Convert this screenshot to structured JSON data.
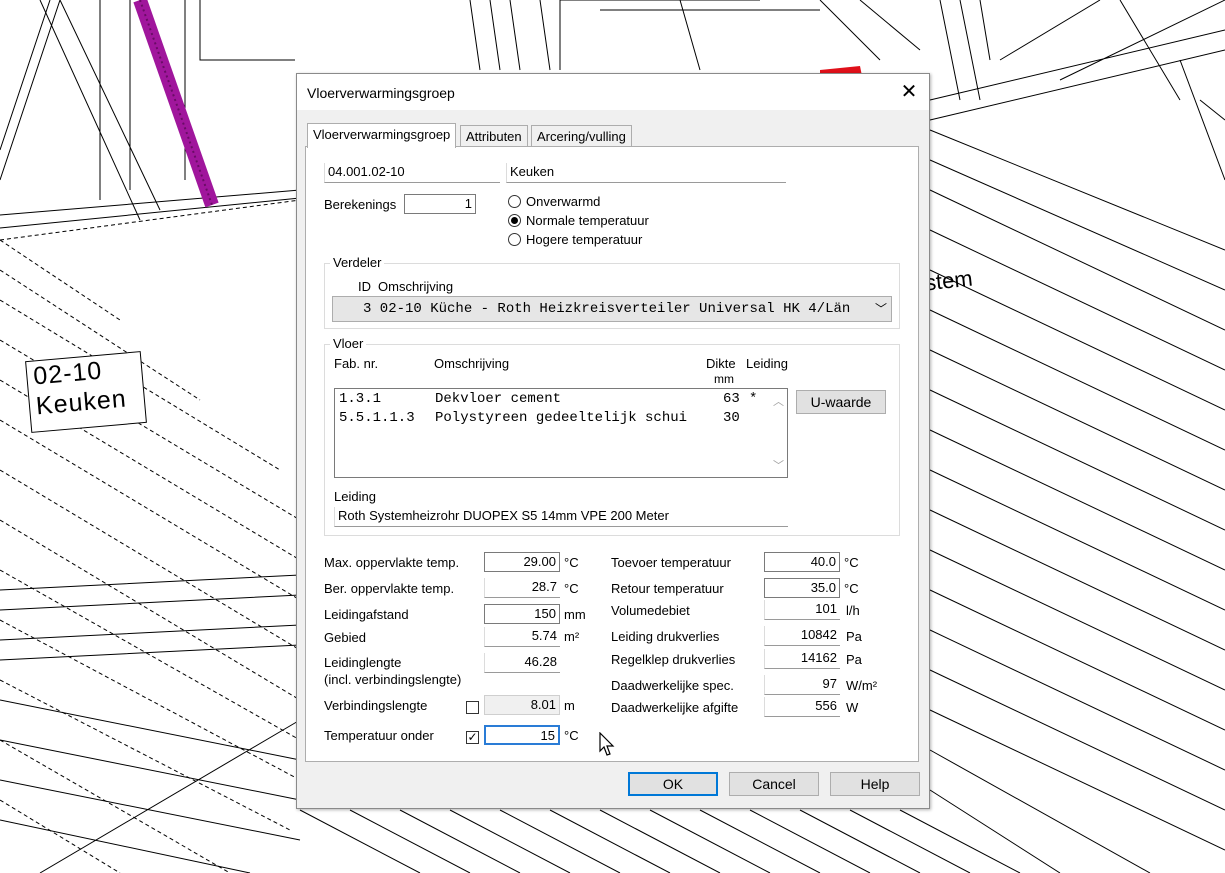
{
  "cad": {
    "room_label": {
      "number": "02-10",
      "name": "Keuken"
    },
    "partial_text": "stem"
  },
  "dialog": {
    "title": "Vloerverwarmingsgroep",
    "tabs": [
      "Vloerverwarmingsgroep",
      "Attributen",
      "Arcering/vulling"
    ],
    "active_tab": 0,
    "group_id": "04.001.02-10",
    "room_name": "Keuken",
    "berekening_label": "Berekenings",
    "berekening_value": "1",
    "temperature_options": [
      {
        "label": "Onverwarmd",
        "selected": false
      },
      {
        "label": "Normale temperatuur",
        "selected": true
      },
      {
        "label": "Hogere temperatuur",
        "selected": false
      }
    ],
    "verdeler": {
      "group_label": "Verdeler",
      "col_id": "ID",
      "col_desc": "Omschrijving",
      "selected": "3 02-10 Küche - Roth Heizkreisverteiler Universal HK 4/Län"
    },
    "vloer": {
      "group_label": "Vloer",
      "col_fab": "Fab. nr.",
      "col_desc": "Omschrijving",
      "col_dikte": "Dikte",
      "col_dikte_unit": "mm",
      "col_leiding": "Leiding",
      "rows": [
        {
          "fab": "1.3.1",
          "desc": "Dekvloer cement",
          "dikte": "63",
          "leiding": "*"
        },
        {
          "fab": "5.5.1.1.3",
          "desc": "Polystyreen gedeeltelijk schui",
          "dikte": "30",
          "leiding": ""
        }
      ],
      "uwaarde_button": "U-waarde",
      "leiding_label": "Leiding",
      "leiding_value": "Roth Systemheizrohr DUOPEX S5 14mm VPE 200 Meter"
    },
    "left_fields": [
      {
        "label": "Max. oppervlakte temp.",
        "value": "29.00",
        "unit": "°C"
      },
      {
        "label": "Ber. oppervlakte temp.",
        "value": "28.7",
        "unit": "°C"
      },
      {
        "label": "Leidingafstand",
        "value": "150",
        "unit": "mm"
      },
      {
        "label": "Gebied",
        "value": "5.74",
        "unit": "m²"
      },
      {
        "label": "Leidinglengte",
        "label2": "(incl. verbindingslengte)",
        "value": "46.28",
        "unit": ""
      },
      {
        "label": "Verbindingslengte",
        "value": "8.01",
        "unit": "m",
        "checkbox": false
      },
      {
        "label": "Temperatuur onder",
        "value": "15",
        "unit": "°C",
        "checkbox": true
      }
    ],
    "right_fields": [
      {
        "label": "Toevoer temperatuur",
        "value": "40.0",
        "unit": "°C"
      },
      {
        "label": "Retour temperatuur",
        "value": "35.0",
        "unit": "°C"
      },
      {
        "label": "Volumedebiet",
        "value": "101",
        "unit": "l/h"
      },
      {
        "label": "Leiding drukverlies",
        "value": "10842",
        "unit": "Pa"
      },
      {
        "label": "Regelklep drukverlies",
        "value": "14162",
        "unit": "Pa"
      },
      {
        "label": "Daadwerkelijke spec.",
        "value": "97",
        "unit": "W/m²"
      },
      {
        "label": "Daadwerkelijke afgifte",
        "value": "556",
        "unit": "W"
      }
    ],
    "buttons": {
      "ok": "OK",
      "cancel": "Cancel",
      "help": "Help"
    }
  },
  "colors": {
    "pipe": "#a0169c",
    "focus": "#2a7cd6",
    "default_button": "#0078d7"
  }
}
